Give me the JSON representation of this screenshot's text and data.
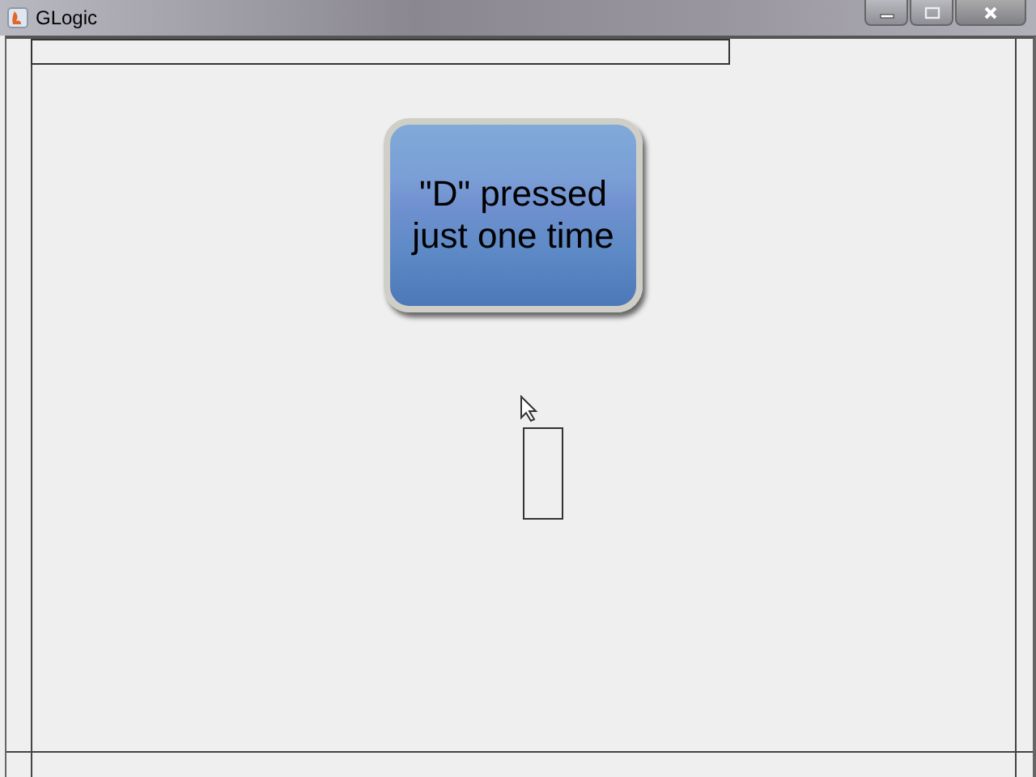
{
  "window": {
    "title": "GLogic"
  },
  "canvas": {
    "message_button": {
      "lines": [
        "\"D\" pressed",
        "just one time"
      ]
    }
  }
}
